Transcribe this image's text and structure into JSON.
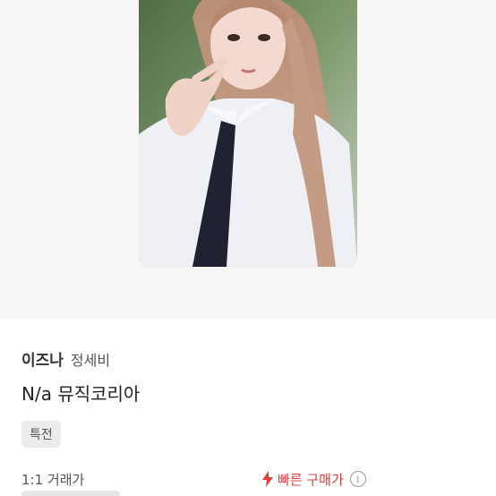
{
  "product": {
    "artist": "이즈나",
    "member": "정세비",
    "title": "N/a 뮤직코리아",
    "tag": "특전",
    "photo_icon": "photocard-image"
  },
  "trade": {
    "type_label": "1:1 거래가",
    "quick_buy_label": "빠른 구매가",
    "quick_buy_icon": "lightning-icon",
    "info_icon": "info-icon",
    "accent_color": "#e63d3d"
  }
}
